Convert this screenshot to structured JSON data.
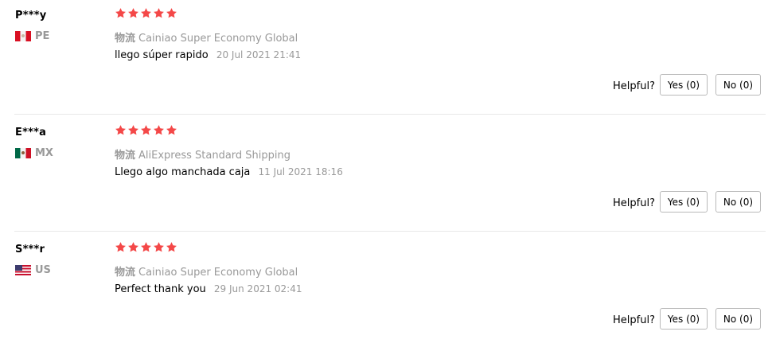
{
  "reviews": [
    {
      "user": "P***y",
      "country": {
        "code": "PE",
        "flag_icon": "peru-flag-icon"
      },
      "rating": 5,
      "shipping": {
        "label": "物流",
        "method": "Cainiao Super Economy Global"
      },
      "comment": "llego súper rapido",
      "date": "20 Jul 2021 21:41",
      "helpful_label": "Helpful?",
      "yes_label": "Yes (0)",
      "no_label": "No (0)"
    },
    {
      "user": "E***a",
      "country": {
        "code": "MX",
        "flag_icon": "mexico-flag-icon"
      },
      "rating": 5,
      "shipping": {
        "label": "物流",
        "method": "AliExpress Standard Shipping"
      },
      "comment": "Llego algo manchada caja",
      "date": "11 Jul 2021 18:16",
      "helpful_label": "Helpful?",
      "yes_label": "Yes (0)",
      "no_label": "No (0)"
    },
    {
      "user": "S***r",
      "country": {
        "code": "US",
        "flag_icon": "us-flag-icon"
      },
      "rating": 5,
      "shipping": {
        "label": "物流",
        "method": "Cainiao Super Economy Global"
      },
      "comment": "Perfect thank you",
      "date": "29 Jun 2021 02:41",
      "helpful_label": "Helpful?",
      "yes_label": "Yes (0)",
      "no_label": "No (0)"
    }
  ],
  "colors": {
    "star": "#f44848",
    "muted_text": "#999999",
    "button_border": "#b9b9b9",
    "divider": "#e8e8e8"
  }
}
